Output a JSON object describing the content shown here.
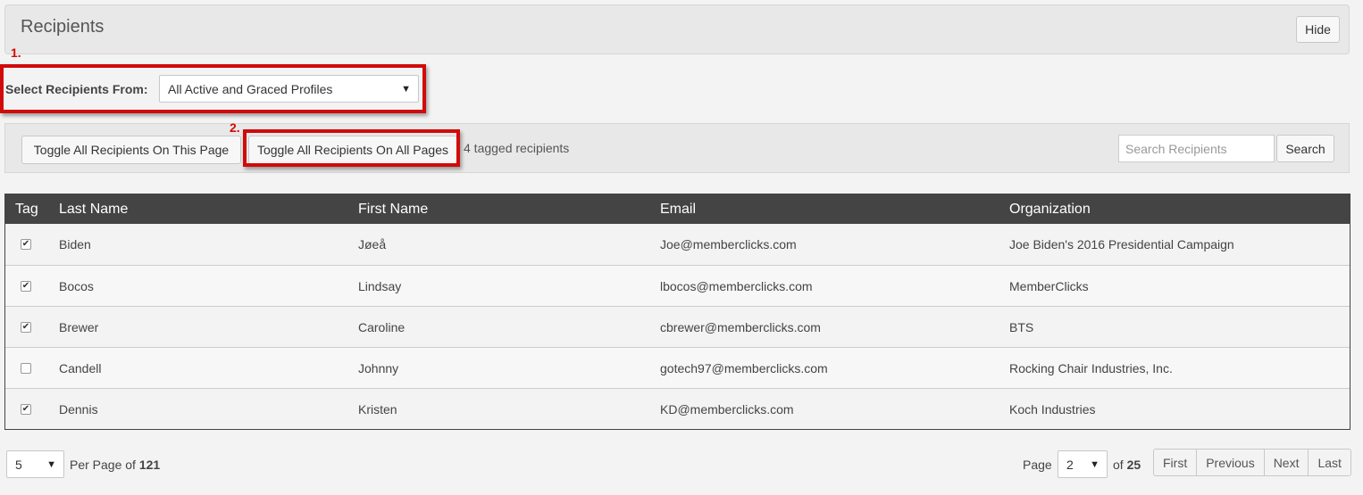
{
  "panel": {
    "title": "Recipients",
    "hide_label": "Hide"
  },
  "annotations": {
    "one": "1.",
    "two": "2."
  },
  "source": {
    "label": "Select Recipients From:",
    "selected": "All Active and Graced Profiles"
  },
  "toolbar": {
    "toggle_page_label": "Toggle All Recipients On This Page",
    "toggle_all_label": "Toggle All Recipients On All Pages",
    "tagged_text": "4 tagged recipients",
    "search_placeholder": "Search Recipients",
    "search_label": "Search"
  },
  "table": {
    "columns": [
      "Tag",
      "Last Name",
      "First Name",
      "Email",
      "Organization"
    ],
    "rows": [
      {
        "tagged": true,
        "last": "Biden",
        "first": "Jøeå",
        "email": "Joe@memberclicks.com",
        "org": "Joe Biden's 2016 Presidential Campaign"
      },
      {
        "tagged": true,
        "last": "Bocos",
        "first": "Lindsay",
        "email": "lbocos@memberclicks.com",
        "org": "MemberClicks"
      },
      {
        "tagged": true,
        "last": "Brewer",
        "first": "Caroline",
        "email": "cbrewer@memberclicks.com",
        "org": "BTS"
      },
      {
        "tagged": false,
        "last": "Candell",
        "first": "Johnny",
        "email": "gotech97@memberclicks.com",
        "org": "Rocking Chair Industries, Inc."
      },
      {
        "tagged": true,
        "last": "Dennis",
        "first": "Kristen",
        "email": "KD@memberclicks.com",
        "org": "Koch Industries"
      }
    ]
  },
  "pagination": {
    "per_page_value": "5",
    "per_page_text": "Per Page of",
    "total": "121",
    "page_label": "Page",
    "current_page": "2",
    "of_text": "of",
    "total_pages": "25",
    "first_label": "First",
    "previous_label": "Previous",
    "next_label": "Next",
    "last_label": "Last"
  },
  "colors": {
    "annotation": "#d10a0a",
    "table_header_bg": "#444444"
  }
}
